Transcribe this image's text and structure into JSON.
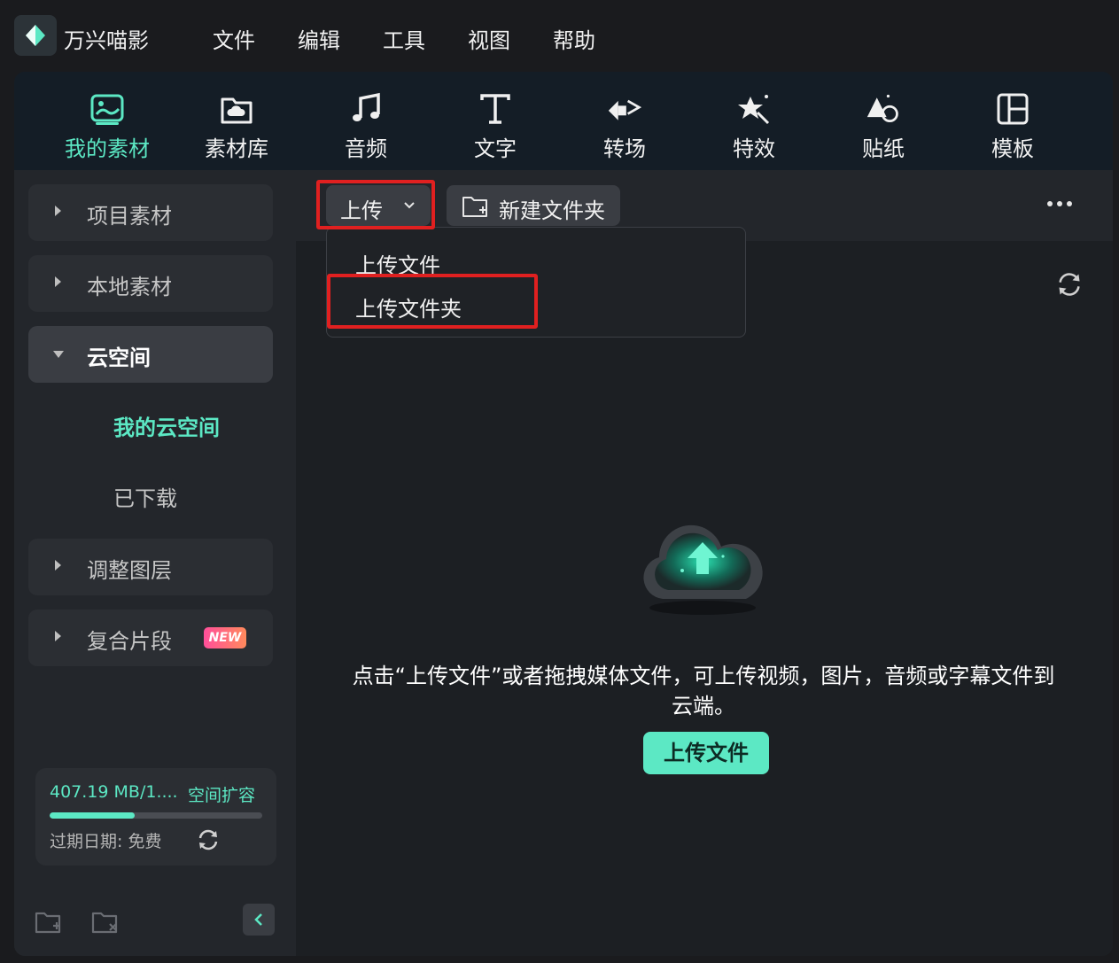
{
  "app": {
    "name": "万兴喵影"
  },
  "menu": [
    "文件",
    "编辑",
    "工具",
    "视图",
    "帮助"
  ],
  "toolbar": {
    "tabs": [
      {
        "label": "我的素材",
        "icon": "media-icon",
        "active": true
      },
      {
        "label": "素材库",
        "icon": "cloud-folder-icon",
        "active": false
      },
      {
        "label": "音频",
        "icon": "music-note-icon",
        "active": false
      },
      {
        "label": "文字",
        "icon": "text-icon",
        "active": false
      },
      {
        "label": "转场",
        "icon": "transition-icon",
        "active": false
      },
      {
        "label": "特效",
        "icon": "effects-star-icon",
        "active": false
      },
      {
        "label": "贴纸",
        "icon": "sticker-icon",
        "active": false
      },
      {
        "label": "模板",
        "icon": "template-icon",
        "active": false
      }
    ]
  },
  "sidebar": {
    "items": [
      {
        "label": "项目素材",
        "expanded": false
      },
      {
        "label": "本地素材",
        "expanded": false
      },
      {
        "label": "云空间",
        "expanded": true
      },
      {
        "label": "调整图层",
        "expanded": false
      },
      {
        "label": "复合片段",
        "expanded": false,
        "badge": "NEW"
      }
    ],
    "sub_items": [
      {
        "label": "我的云空间",
        "selected": true
      },
      {
        "label": "已下载",
        "selected": false
      }
    ],
    "storage": {
      "used_text": "407.19 MB/1....",
      "expand_label": "空间扩容",
      "expiry_text": "过期日期:  免费",
      "usage_fraction": 0.4
    }
  },
  "content": {
    "upload_label": "上传",
    "new_folder_label": "新建文件夹",
    "dropdown": [
      "上传文件",
      "上传文件夹"
    ],
    "empty_message": "点击“上传文件”或者拖拽媒体文件，可上传视频，图片，音频或字幕文件到云端。",
    "upload_button": "上传文件"
  },
  "colors": {
    "accent": "#5ce8c4",
    "highlight": "#e02020",
    "panel": "#202328",
    "toolbar": "#141d26"
  }
}
